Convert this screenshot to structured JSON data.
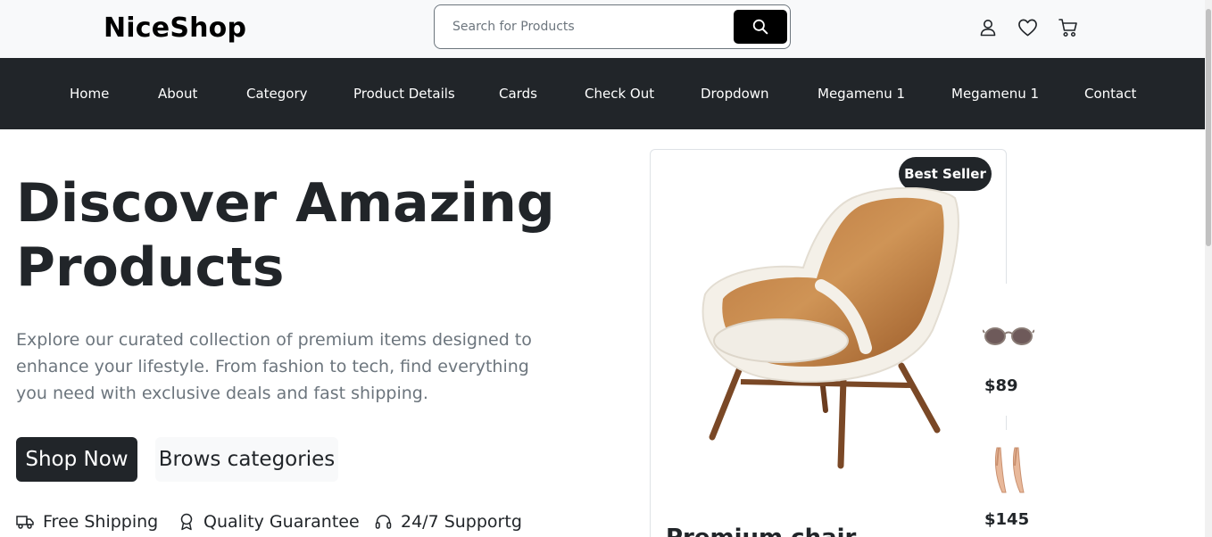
{
  "header": {
    "logo": "NiceShop",
    "search": {
      "placeholder": "Search for Products",
      "value": ""
    },
    "icons": [
      "user-icon",
      "heart-icon",
      "cart-icon"
    ]
  },
  "nav": {
    "items": [
      {
        "label": "Home"
      },
      {
        "label": "About"
      },
      {
        "label": "Category"
      },
      {
        "label": "Product Details"
      },
      {
        "label": "Cards"
      },
      {
        "label": "Check Out"
      },
      {
        "label": "Dropdown"
      },
      {
        "label": "Megamenu 1"
      },
      {
        "label": "Megamenu 1"
      },
      {
        "label": "Contact"
      }
    ]
  },
  "hero": {
    "title_line1": "Discover Amazing",
    "title_line2": "Products",
    "description": "Explore our curated collection of premium items designed to enhance your lifestyle. From fashion to tech, find everything you need with exclusive deals and fast shipping.",
    "primary_button": "Shop Now",
    "secondary_button": "Brows categories",
    "features": [
      {
        "icon": "truck-icon",
        "label": "Free Shipping"
      },
      {
        "icon": "award-icon",
        "label": "Quality Guarantee"
      },
      {
        "icon": "headset-icon",
        "label": "24/7 Supportg"
      }
    ]
  },
  "product_card": {
    "badge": "Best Seller",
    "image": "armchair-image",
    "title": "Premium chair"
  },
  "mini_products": [
    {
      "image": "sunglasses-image",
      "price": "$89"
    },
    {
      "image": "heels-image",
      "price": "$145"
    }
  ],
  "colors": {
    "dark": "#212529",
    "light": "#f8f9fa",
    "muted": "#6c757d",
    "black": "#000000"
  }
}
